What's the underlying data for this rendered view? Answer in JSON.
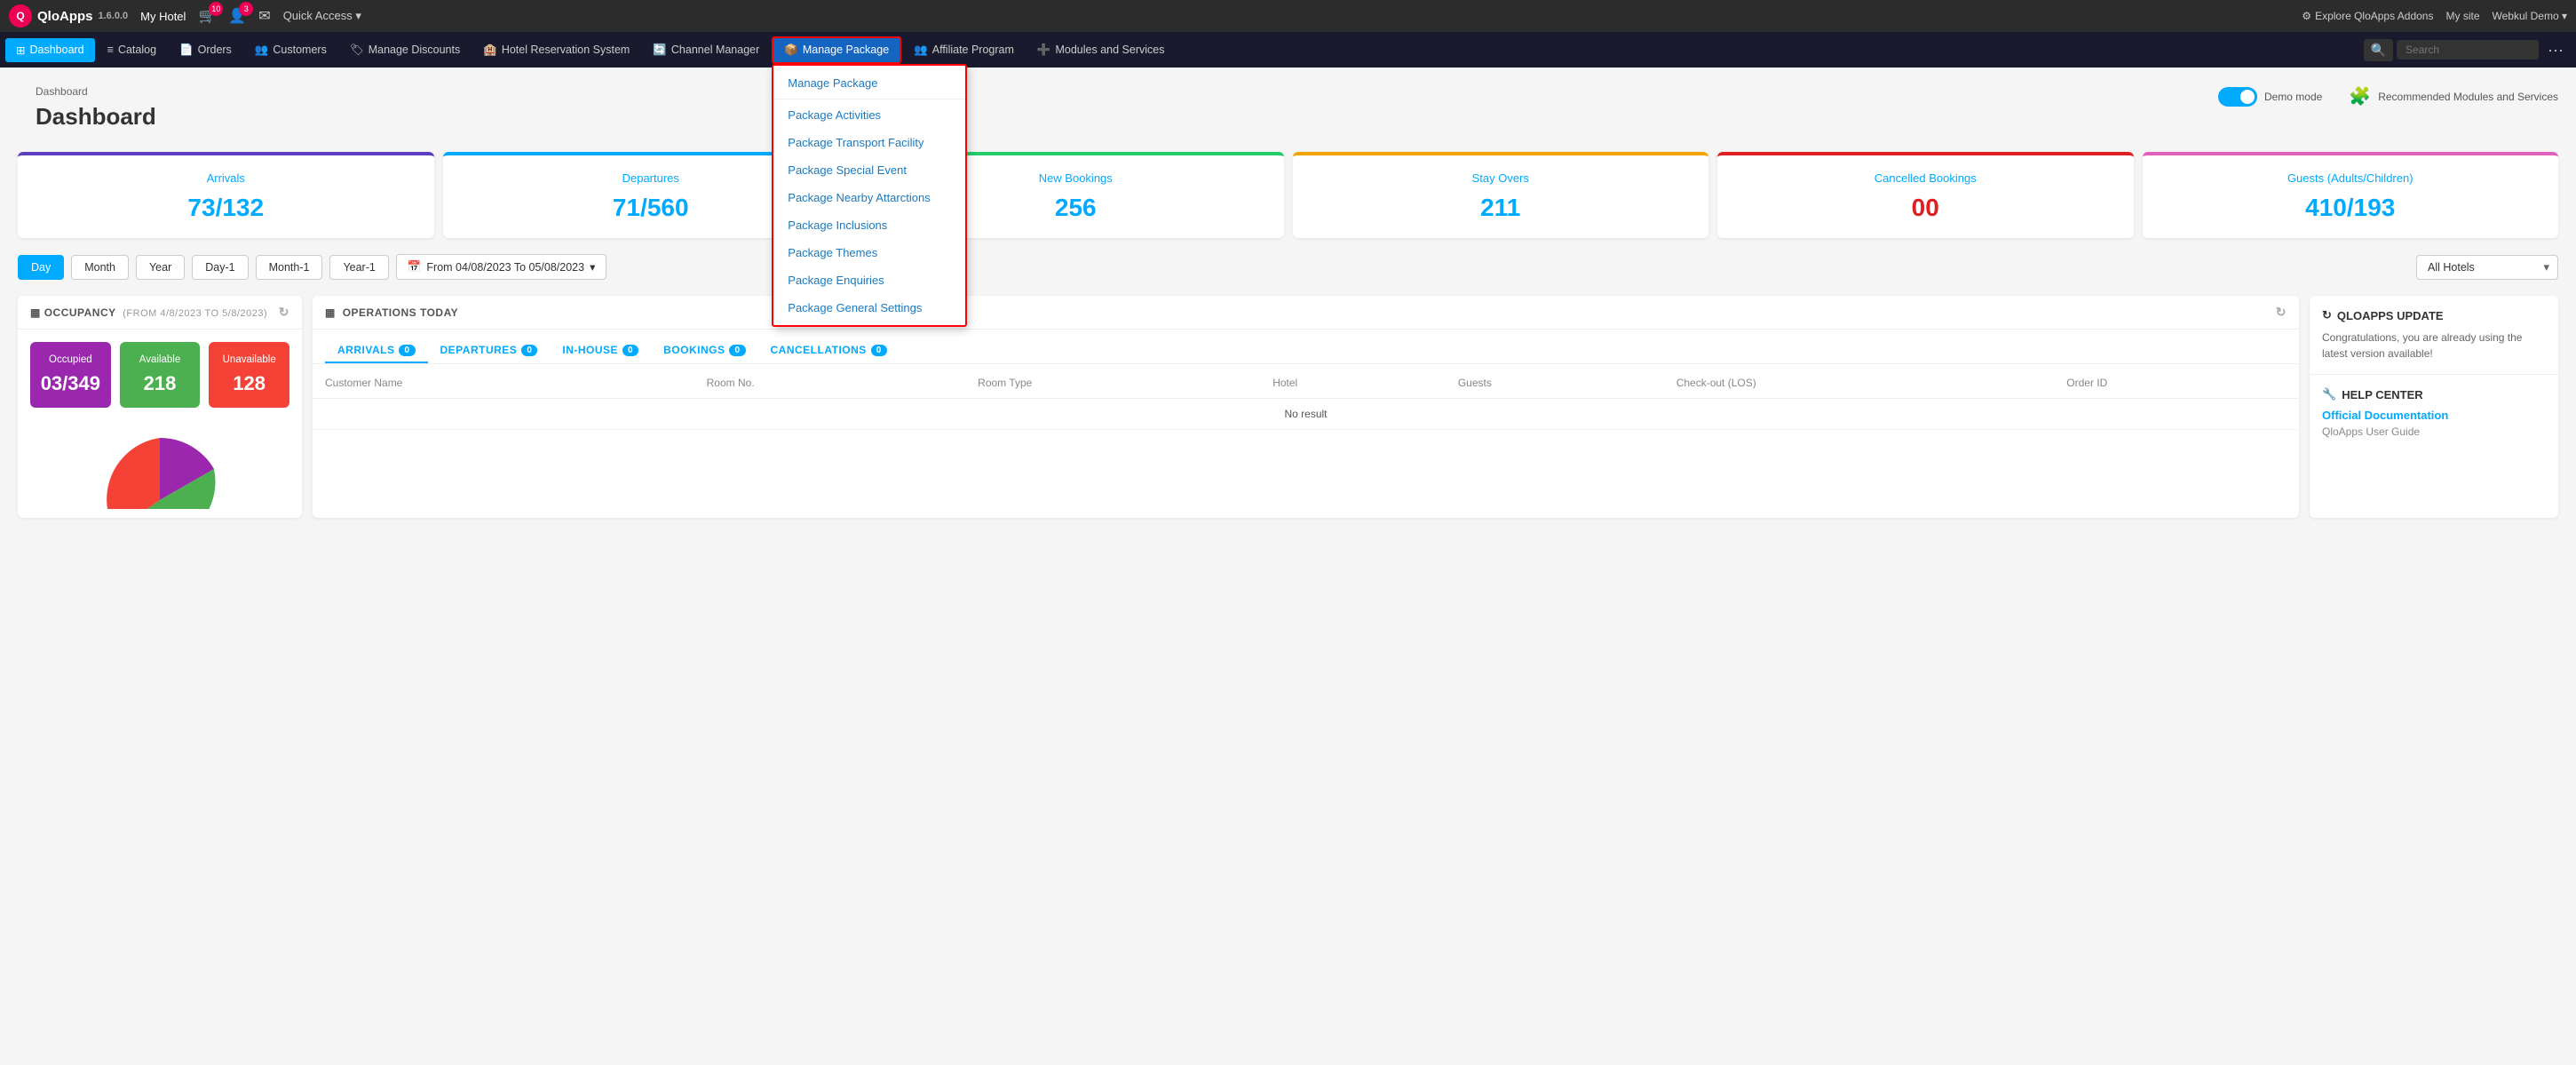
{
  "app": {
    "logo_text": "QloApps",
    "version": "1.6.0.0",
    "hotel": "My Hotel",
    "cart_badge": "10",
    "user_badge": "3",
    "quick_access": "Quick Access ▾",
    "explore_addons": "Explore QloApps Addons",
    "my_site": "My site",
    "webkul_demo": "Webkul Demo ▾"
  },
  "main_nav": {
    "items": [
      {
        "id": "dashboard",
        "label": "Dashboard",
        "icon": "⊞",
        "active": true
      },
      {
        "id": "catalog",
        "label": "Catalog",
        "icon": "≡"
      },
      {
        "id": "orders",
        "label": "Orders",
        "icon": "📄"
      },
      {
        "id": "customers",
        "label": "Customers",
        "icon": "👥"
      },
      {
        "id": "manage-discounts",
        "label": "Manage Discounts",
        "icon": "🏷"
      },
      {
        "id": "hotel-reservation",
        "label": "Hotel Reservation System",
        "icon": "🏨"
      },
      {
        "id": "channel-manager",
        "label": "Channel Manager",
        "icon": "🔄"
      },
      {
        "id": "manage-package",
        "label": "Manage Package",
        "icon": "📦",
        "highlighted": true
      },
      {
        "id": "affiliate-program",
        "label": "Affiliate Program",
        "icon": "👥"
      },
      {
        "id": "modules-services",
        "label": "Modules and Services",
        "icon": "➕"
      }
    ],
    "search_placeholder": "Search"
  },
  "dropdown": {
    "title": "Manage Package",
    "items": [
      {
        "id": "manage-package",
        "label": "Manage Package"
      },
      {
        "id": "package-activities",
        "label": "Package Activities"
      },
      {
        "id": "package-transport",
        "label": "Package Transport Facility"
      },
      {
        "id": "package-special-event",
        "label": "Package Special Event"
      },
      {
        "id": "package-nearby",
        "label": "Package Nearby Attarctions"
      },
      {
        "id": "package-inclusions",
        "label": "Package Inclusions"
      },
      {
        "id": "package-themes",
        "label": "Package Themes"
      },
      {
        "id": "package-enquiries",
        "label": "Package Enquiries"
      },
      {
        "id": "package-general",
        "label": "Package General Settings"
      }
    ]
  },
  "page": {
    "breadcrumb": "Dashboard",
    "title": "Dashboard"
  },
  "widgets": {
    "demo_mode_label": "Demo mode",
    "recommended_label": "Recommended Modules and Services"
  },
  "stats": [
    {
      "id": "arrivals",
      "label": "Arrivals",
      "value": "73/132",
      "color_class": "arrivals"
    },
    {
      "id": "departures",
      "label": "Departures",
      "value": "71/560",
      "color_class": "departures"
    },
    {
      "id": "new-bookings",
      "label": "New Bookings",
      "value": "256",
      "color_class": "new-bookings"
    },
    {
      "id": "stay-overs",
      "label": "Stay Overs",
      "value": "211",
      "color_class": "stay-overs"
    },
    {
      "id": "cancelled",
      "label": "Cancelled Bookings",
      "value": "00",
      "color_class": "cancelled"
    },
    {
      "id": "guests",
      "label": "Guests (Adults/Children)",
      "value": "410/193",
      "color_class": "guests"
    }
  ],
  "filters": {
    "buttons": [
      {
        "id": "day",
        "label": "Day",
        "active": true
      },
      {
        "id": "month",
        "label": "Month"
      },
      {
        "id": "year",
        "label": "Year"
      },
      {
        "id": "day-1",
        "label": "Day-1"
      },
      {
        "id": "month-1",
        "label": "Month-1"
      },
      {
        "id": "year-1",
        "label": "Year-1"
      }
    ],
    "date_range": "From 04/08/2023 To 05/08/2023",
    "hotel_select": "All Hotels"
  },
  "occupancy": {
    "panel_title": "OCCUPANCY",
    "date_range": "(FROM 4/8/2023 TO 5/8/2023)",
    "boxes": [
      {
        "id": "occupied",
        "label": "Occupied",
        "value": "03/349",
        "color_class": "occupied"
      },
      {
        "id": "available",
        "label": "Available",
        "value": "218",
        "color_class": "available"
      },
      {
        "id": "unavailable",
        "label": "Unavailable",
        "value": "128",
        "color_class": "unavailable"
      }
    ]
  },
  "operations": {
    "panel_title": "OPERATIONS TODAY",
    "tabs": [
      {
        "id": "arrivals",
        "label": "ARRIVALS",
        "count": "0",
        "active": true
      },
      {
        "id": "departures",
        "label": "DEPARTURES",
        "count": "0"
      },
      {
        "id": "in-house",
        "label": "IN-HOUSE",
        "count": "0"
      },
      {
        "id": "bookings",
        "label": "BOOKINGS",
        "count": "0"
      },
      {
        "id": "cancellations",
        "label": "CANCELLATIONS",
        "count": "0"
      }
    ],
    "columns": [
      "Customer Name",
      "Room No.",
      "Room Type",
      "Hotel",
      "Guests",
      "Check-out (LOS)",
      "Order ID"
    ],
    "no_result": "No result"
  },
  "right_panel": {
    "update_title": "QLOAPPS UPDATE",
    "update_icon": "↻",
    "update_text": "Congratulations, you are already using the latest version available!",
    "help_title": "HELP CENTER",
    "help_icon": "🔧",
    "help_link": "Official Documentation",
    "help_sub": "QloApps User Guide"
  }
}
